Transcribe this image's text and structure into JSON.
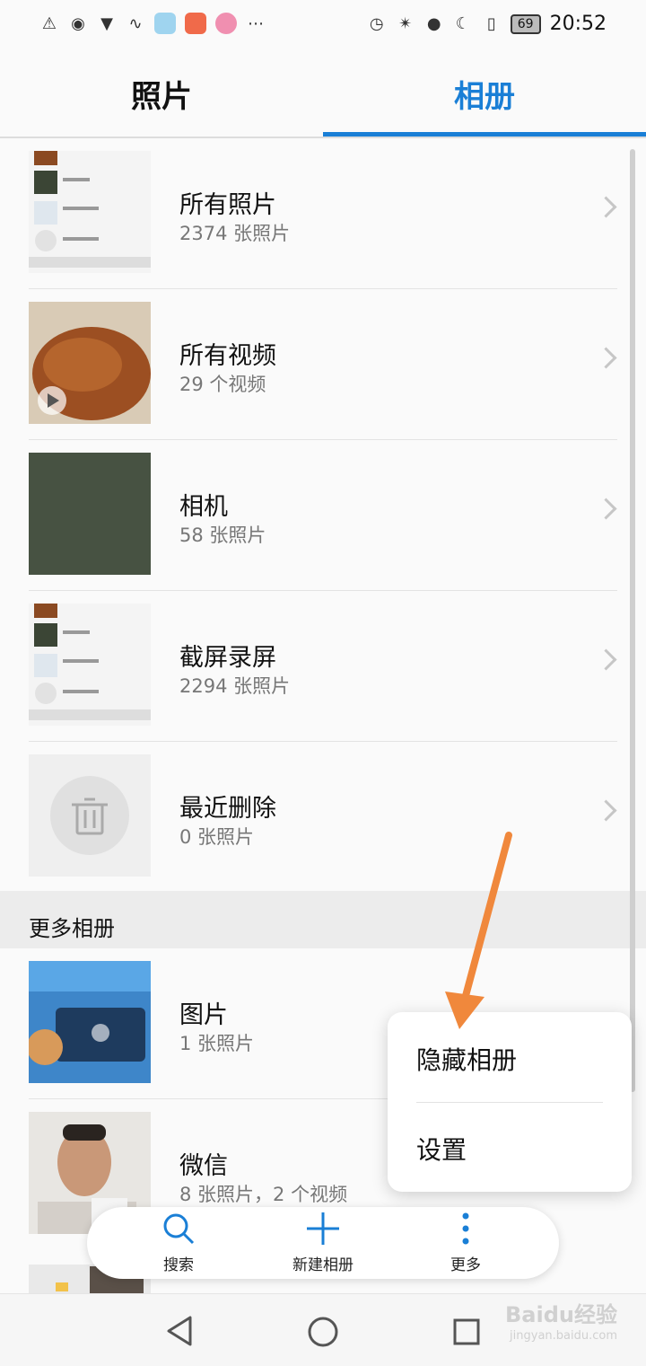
{
  "status_bar": {
    "time": "20:52",
    "battery": "69"
  },
  "tabs": {
    "photos": "照片",
    "albums": "相册"
  },
  "albums": [
    {
      "title": "所有照片",
      "count": "2374 张照片"
    },
    {
      "title": "所有视频",
      "count": "29 个视频"
    },
    {
      "title": "相机",
      "count": "58 张照片"
    },
    {
      "title": "截屏录屏",
      "count": "2294 张照片"
    },
    {
      "title": "最近删除",
      "count": "0 张照片"
    }
  ],
  "section": {
    "more_albums": "更多相册"
  },
  "more_albums": [
    {
      "title": "图片",
      "count": "1 张照片"
    },
    {
      "title": "微信",
      "count": "8 张照片，2 个视频"
    }
  ],
  "popup_menu": {
    "hide_albums": "隐藏相册",
    "settings": "设置"
  },
  "bottom_bar": {
    "search": "搜索",
    "new_album": "新建相册",
    "more": "更多"
  },
  "watermark": {
    "brand": "Baidu经验",
    "url": "jingyan.baidu.com"
  },
  "colors": {
    "accent": "#1a7fd6",
    "annotation_arrow": "#f0883c"
  }
}
